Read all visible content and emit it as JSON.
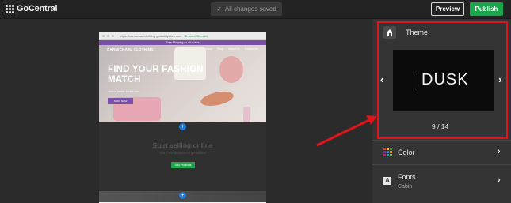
{
  "header": {
    "app_name": "GoCentral",
    "save_status": "All changes saved",
    "preview_label": "Preview",
    "publish_label": "Publish"
  },
  "site_preview": {
    "url": "https://carmichaelclothing.godaddysites.com",
    "connection": "Connect Domain",
    "promo_banner": "Free Shipping on all orders",
    "site_name": "CARMICHAEL CLOTHING",
    "nav_links": [
      "Home",
      "Shop",
      "About Us",
      "Contact Us"
    ],
    "hero_title": "FIND YOUR FASHION MATCH",
    "hero_subtitle": "Visit us to see what's new",
    "hero_button": "SHOP NOW",
    "sell_title": "Start selling online",
    "sell_subtitle": "Add a few products to get started",
    "sell_button": "Add Products",
    "add_section_symbol": "+"
  },
  "panel": {
    "theme_label": "Theme",
    "current_theme": "DUSK",
    "theme_position": "9 / 14",
    "color_label": "Color",
    "fonts_label": "Fonts",
    "fonts_value": "Cabin"
  },
  "colors": {
    "accent_green": "#1aa64a",
    "highlight_red": "#e0141b",
    "brand_purple": "#7a4fa6",
    "dusk_accent": "#c05bc4"
  },
  "color_swatches": [
    "#e53935",
    "#fbc02d",
    "#43a047",
    "#8e24aa",
    "#1e88e5",
    "#fb8c00",
    "#d81b60",
    "#00acc1",
    "#7cb342"
  ]
}
